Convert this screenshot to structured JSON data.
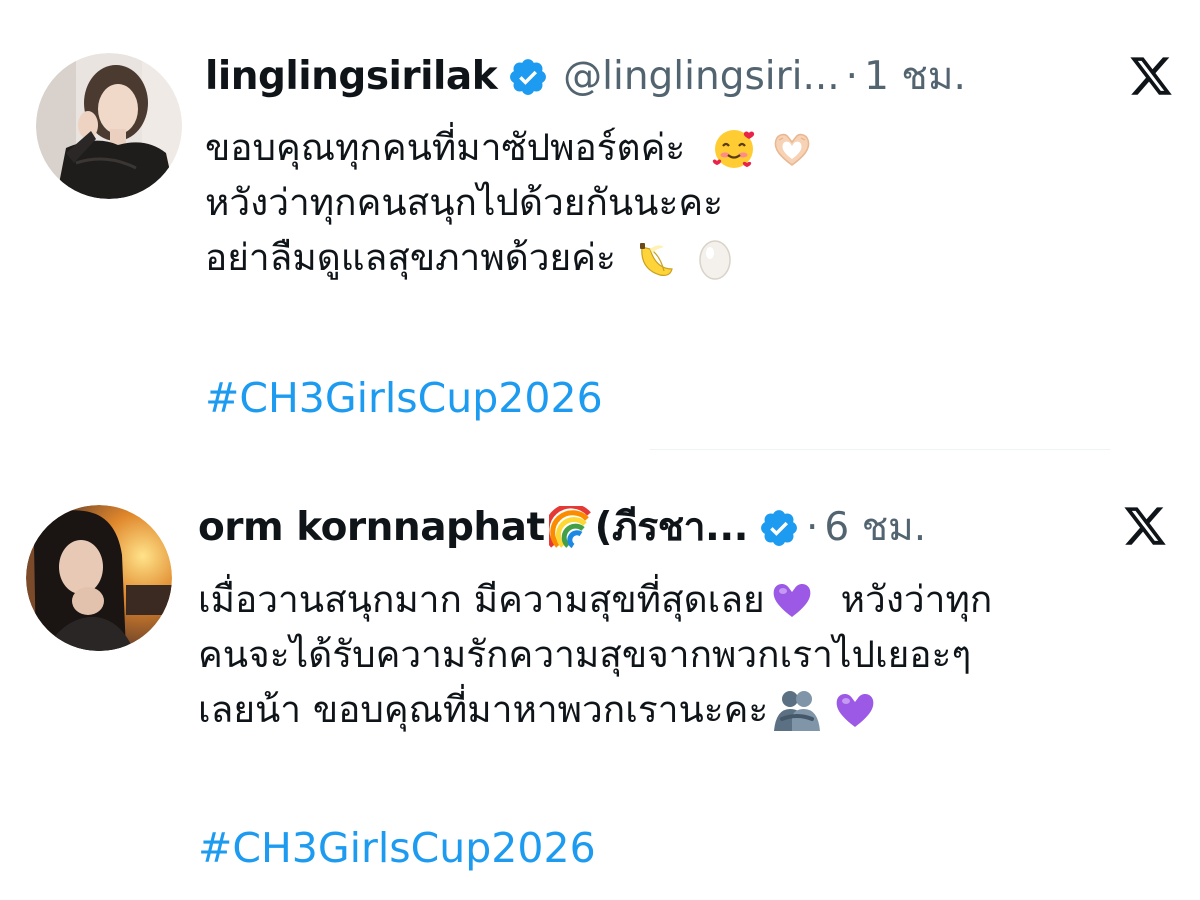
{
  "tweets": [
    {
      "display_name": "linglingsirilak",
      "handle": "@linglingsiri...",
      "separator": "·",
      "time": "1 ชม.",
      "lines": [
        "ขอบคุณทุกคนที่มาซัปพอร์ตค่ะ",
        "หวังว่าทุกคนสนุกไปด้วยกันนะคะ",
        "อย่าลืมดูแลสุขภาพด้วยค่ะ"
      ],
      "line_emojis": [
        [
          "smiling-face-with-hearts",
          "heart-hands"
        ],
        [],
        [
          "banana",
          "egg"
        ]
      ],
      "hashtag": "#CH3GirlsCup2026",
      "verified": true
    },
    {
      "display_name": "orm kornnaphat",
      "display_name_suffix": "(ภีรชา...",
      "name_emoji": "rainbow",
      "separator": "·",
      "time": "6 ชม.",
      "lines": [
        "เมื่อวานสนุกมาก มีความสุขที่สุดเลย",
        "หวังว่าทุก",
        "คนจะได้รับความรักความสุขจากพวกเราไปเยอะๆ",
        "เลยน้า ขอบคุณที่มาหาพวกเรานะคะ"
      ],
      "line_emojis": [
        [
          "purple-heart"
        ],
        [],
        [
          "people-hugging",
          "purple-heart"
        ]
      ],
      "hashtag": "#CH3GirlsCup2026",
      "verified": true
    }
  ],
  "colors": {
    "text": "#0f1419",
    "secondary": "#536471",
    "link": "#1d9bf0",
    "verified": "#1d9bf0"
  },
  "icons": [
    "verified-badge-icon",
    "x-logo-icon"
  ]
}
